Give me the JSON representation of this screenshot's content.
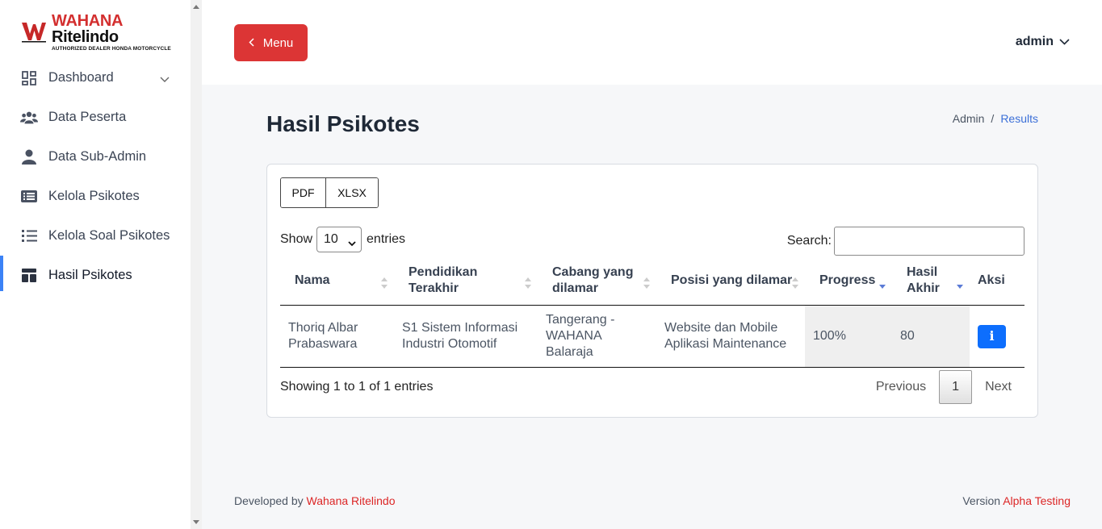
{
  "brand": {
    "name_part1": "WAHANA",
    "name_part2": "Ritelindo",
    "tagline": "AUTHORIZED DEALER HONDA MOTORCYCLE"
  },
  "sidebar": {
    "items": [
      {
        "label": "Dashboard",
        "icon": "dashboard-grid-icon"
      },
      {
        "label": "Data Peserta",
        "icon": "users-icon"
      },
      {
        "label": "Data Sub-Admin",
        "icon": "user-icon"
      },
      {
        "label": "Kelola Psikotes",
        "icon": "list-card-icon"
      },
      {
        "label": "Kelola Soal Psikotes",
        "icon": "list-icon"
      },
      {
        "label": "Hasil Psikotes",
        "icon": "layout-icon",
        "active": true
      }
    ]
  },
  "header": {
    "menu_label": "Menu",
    "user_label": "admin"
  },
  "page": {
    "title": "Hasil Psikotes"
  },
  "breadcrumb": {
    "items": [
      "Admin",
      "Results"
    ]
  },
  "export": {
    "pdf_label": "PDF",
    "xlsx_label": "XLSX"
  },
  "length": {
    "prefix": "Show",
    "value": "10",
    "suffix": "entries"
  },
  "search": {
    "label": "Search:",
    "value": ""
  },
  "table": {
    "columns": [
      "Nama",
      "Pendidikan Terakhir",
      "Cabang yang dilamar",
      "Posisi yang dilamar",
      "Progress",
      "Hasil Akhir",
      "Aksi"
    ],
    "rows": [
      {
        "nama": "Thoriq Albar Prabaswara",
        "pendidikan": "S1 Sistem Informasi Industri Otomotif",
        "cabang": "Tangerang - WAHANA Balaraja",
        "posisi": "Website dan Mobile Aplikasi Maintenance",
        "progress": "100%",
        "hasil": "80",
        "aksi": "i"
      }
    ]
  },
  "info": "Showing 1 to 1 of 1 entries",
  "pager": {
    "previous": "Previous",
    "current": "1",
    "next": "Next"
  },
  "footer": {
    "left_prefix": "Developed by",
    "left_link": "Wahana Ritelindo",
    "right_prefix": "Version",
    "right_link": "Alpha Testing"
  },
  "colors": {
    "menu_button": "#dc3535",
    "active_accent": "#3b82f6",
    "info_button": "#0d6efd",
    "footer_link": "#dc2626"
  }
}
